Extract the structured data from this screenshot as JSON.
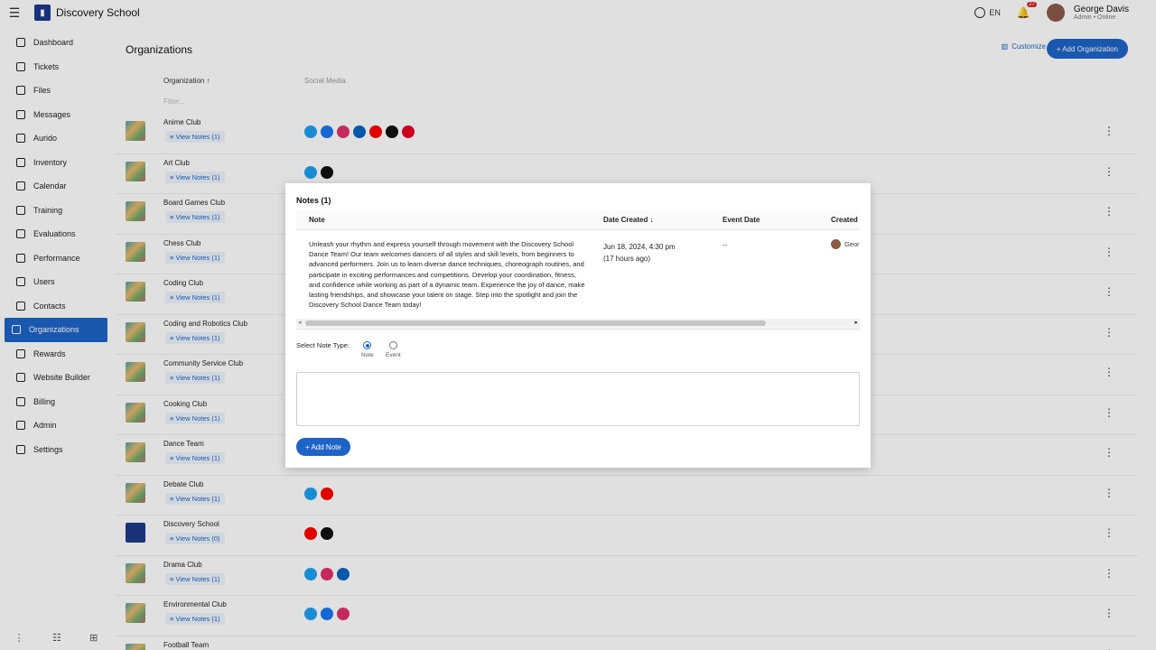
{
  "app": {
    "title": "Discovery School",
    "logo_icon": "book-logo-icon"
  },
  "topbar": {
    "lang": "EN",
    "notification_count": "27",
    "user_name": "George Davis",
    "user_role": "Admin • Online"
  },
  "sidebar": {
    "items": [
      {
        "label": "Dashboard",
        "icon": "grid-icon"
      },
      {
        "label": "Tickets",
        "icon": "tag-icon"
      },
      {
        "label": "Files",
        "icon": "file-icon"
      },
      {
        "label": "Messages",
        "icon": "chat-icon"
      },
      {
        "label": "Aurido",
        "icon": "headset-icon"
      },
      {
        "label": "Inventory",
        "icon": "box-icon"
      },
      {
        "label": "Calendar",
        "icon": "calendar-icon"
      },
      {
        "label": "Training",
        "icon": "book-icon"
      },
      {
        "label": "Evaluations",
        "icon": "clipboard-icon"
      },
      {
        "label": "Performance",
        "icon": "chart-icon"
      },
      {
        "label": "Users",
        "icon": "user-icon"
      },
      {
        "label": "Contacts",
        "icon": "contacts-icon"
      },
      {
        "label": "Organizations",
        "icon": "org-icon",
        "active": true
      },
      {
        "label": "Rewards",
        "icon": "reward-icon"
      },
      {
        "label": "Website Builder",
        "icon": "web-icon"
      },
      {
        "label": "Billing",
        "icon": "billing-icon"
      },
      {
        "label": "Admin",
        "icon": "admin-icon"
      },
      {
        "label": "Settings",
        "icon": "gear-icon"
      }
    ]
  },
  "page": {
    "title": "Organizations",
    "customize_label": "Customize",
    "add_org_label": "+ Add Organization",
    "col_org": "Organization",
    "col_social": "Social Media",
    "filter_placeholder": "Filter..."
  },
  "orgs": [
    {
      "name": "Anime Club",
      "notes": "View Notes (1)",
      "socials": [
        "#1da1f2",
        "#1877f2",
        "#e1306c",
        "#0a66c2",
        "#ff0000",
        "#111111",
        "#e60023"
      ]
    },
    {
      "name": "Art Club",
      "notes": "View Notes (1)",
      "socials": [
        "#1da1f2",
        "#111111"
      ]
    },
    {
      "name": "Board Games Club",
      "notes": "View Notes (1)",
      "socials": []
    },
    {
      "name": "Chess Club",
      "notes": "View Notes (1)",
      "socials": []
    },
    {
      "name": "Coding Club",
      "notes": "View Notes (1)",
      "socials": []
    },
    {
      "name": "Coding and Robotics Club",
      "notes": "View Notes (1)",
      "socials": []
    },
    {
      "name": "Community Service Club",
      "notes": "View Notes (1)",
      "socials": []
    },
    {
      "name": "Cooking Club",
      "notes": "View Notes (1)",
      "socials": []
    },
    {
      "name": "Dance Team",
      "notes": "View Notes (1)",
      "socials": []
    },
    {
      "name": "Debate Club",
      "notes": "View Notes (1)",
      "socials": [
        "#1da1f2",
        "#ff0000"
      ]
    },
    {
      "name": "Discovery School",
      "notes": "View Notes (0)",
      "socials": [
        "#ff0000",
        "#111111"
      ],
      "blue": true
    },
    {
      "name": "Drama Club",
      "notes": "View Notes (1)",
      "socials": [
        "#1da1f2",
        "#e1306c",
        "#0a66c2"
      ]
    },
    {
      "name": "Environmental Club",
      "notes": "View Notes (1)",
      "socials": [
        "#1da1f2",
        "#1877f2",
        "#e1306c"
      ]
    },
    {
      "name": "Football Team",
      "notes": "",
      "socials": []
    }
  ],
  "modal": {
    "title": "Notes (1)",
    "col_note": "Note",
    "col_date": "Date Created",
    "col_event": "Event Date",
    "col_created": "Created",
    "note_text": "Unleash your rhythm and express yourself through movement with the Discovery School Dance Team! Our team welcomes dancers of all styles and skill levels, from beginners to advanced performers. Join us to learn diverse dance techniques, choreograph routines, and participate in exciting performances and competitions. Develop your coordination, fitness, and confidence while working as part of a dynamic team. Experience the joy of dance, make lasting friendships, and showcase your talent on stage. Step into the spotlight and join the Discovery School Dance Team today!",
    "date": "Jun 18, 2024, 4:30 pm",
    "date_rel": "(17 hours ago)",
    "event": "--",
    "creator": "Geor",
    "select_type_label": "Select Note Type:",
    "type_note": "Note",
    "type_event": "Event",
    "add_note_label": "+ Add Note"
  }
}
